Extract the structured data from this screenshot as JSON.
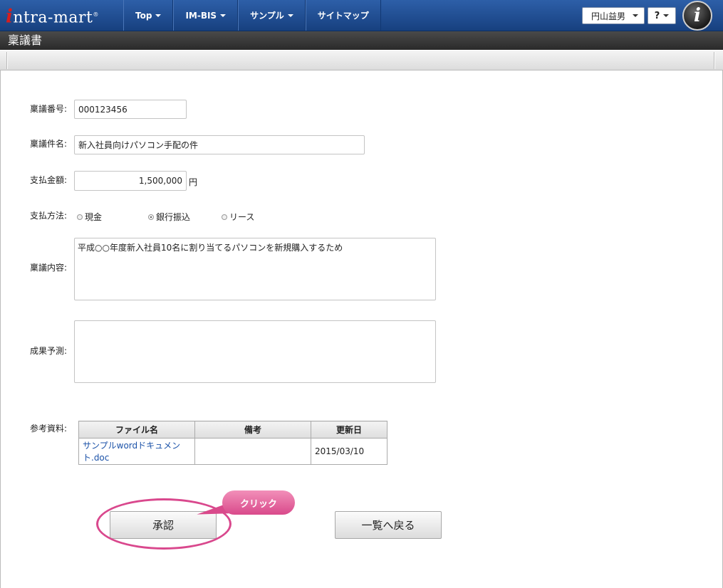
{
  "header": {
    "logo_text": "intra-mart",
    "nav": [
      {
        "label": "Top"
      },
      {
        "label": "IM-BIS"
      },
      {
        "label": "サンプル"
      },
      {
        "label": "サイトマップ"
      }
    ],
    "user_name": "円山益男",
    "help_label": "?",
    "info_badge": "i"
  },
  "page": {
    "title": "稟議書"
  },
  "form": {
    "number_label": "稟議番号:",
    "number_value": "000123456",
    "subject_label": "稟議件名:",
    "subject_value": "新入社員向けパソコン手配の件",
    "amount_label": "支払金額:",
    "amount_value": "1,500,000",
    "amount_unit": "円",
    "method_label": "支払方法:",
    "methods": [
      {
        "label": "現金",
        "selected": false
      },
      {
        "label": "銀行振込",
        "selected": true
      },
      {
        "label": "リース",
        "selected": false
      }
    ],
    "content_label": "稟議内容:",
    "content_value": "平成○○年度新入社員10名に割り当てるパソコンを新規購入するため",
    "expected_label": "成果予測:",
    "expected_value": "",
    "refs_label": "参考資料:"
  },
  "files": {
    "columns": [
      "ファイル名",
      "備考",
      "更新日"
    ],
    "rows": [
      {
        "name": "サンプルwordドキュメント.doc",
        "note": "",
        "date": "2015/03/10"
      }
    ]
  },
  "actions": {
    "approve_label": "承認",
    "back_label": "一覧へ戻る",
    "callout": "クリック"
  },
  "colors": {
    "nav_bg": "#1f4f95",
    "title_bg": "#333333",
    "callout": "#d94a8b",
    "link": "#1b52a8"
  }
}
